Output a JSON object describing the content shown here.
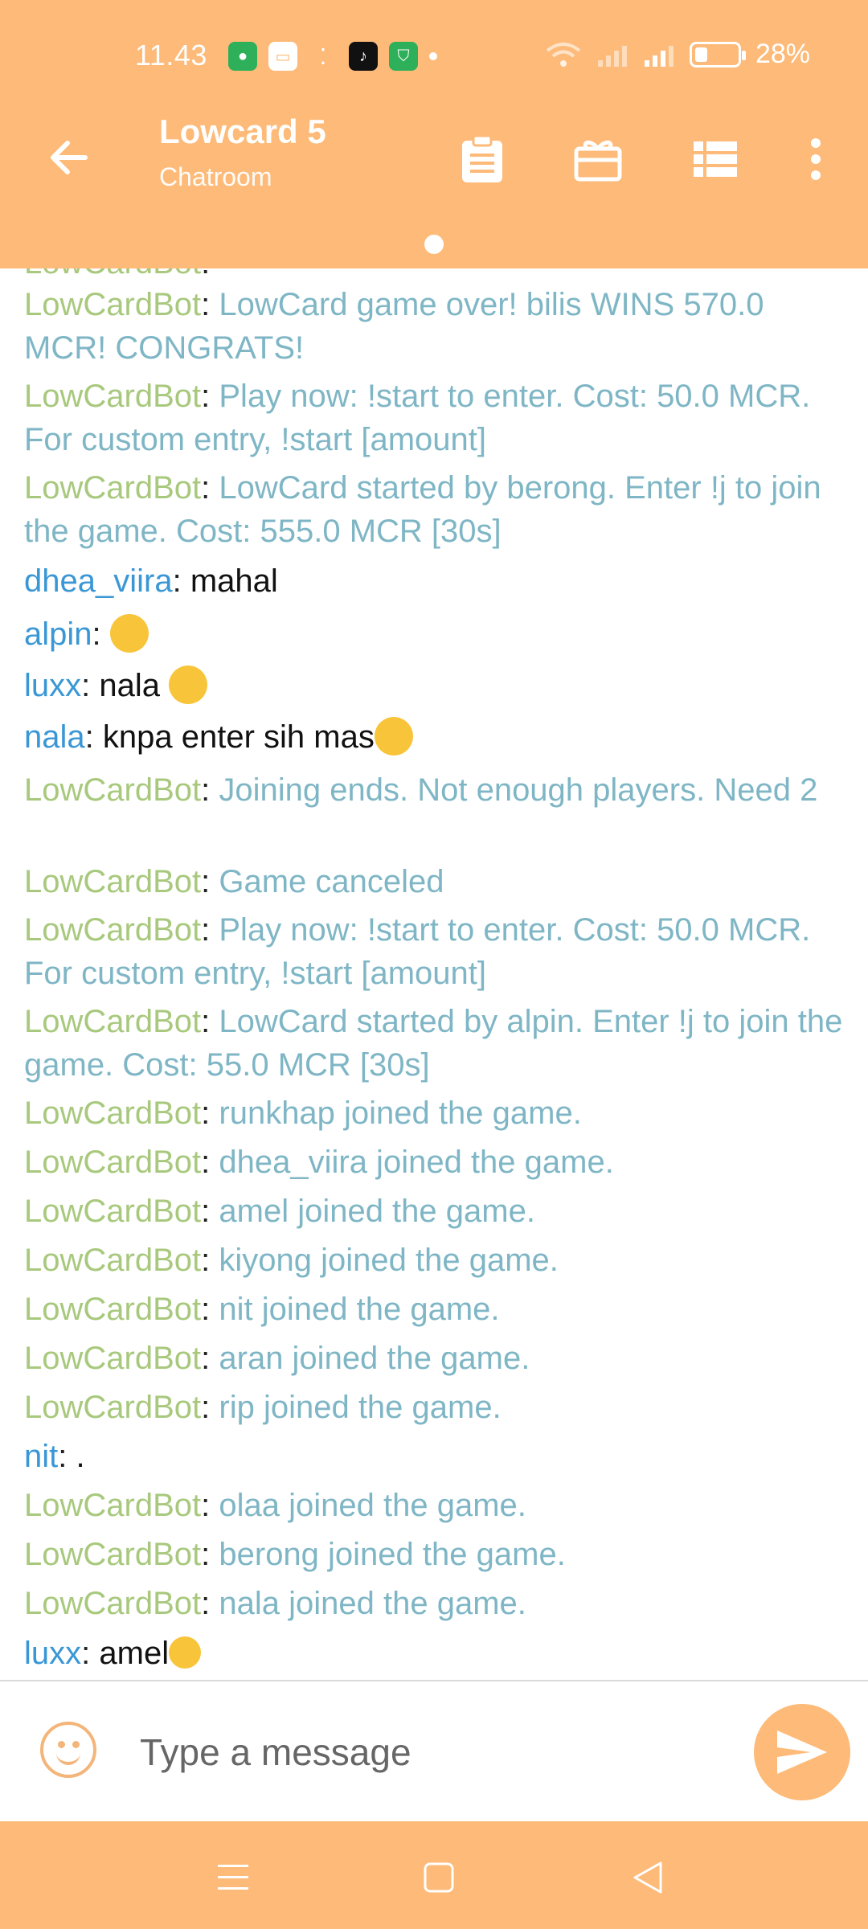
{
  "status_bar": {
    "time": "11.43",
    "battery": "28%",
    "battery_level": 0.28
  },
  "header": {
    "title": "Lowcard 5",
    "subtitle": "Chatroom"
  },
  "chat": {
    "messages": [
      {
        "user": "LowCardBot",
        "text": "LowCard game over! bilis WINS 570.0 MCR! CONGRATS!"
      },
      {
        "user": "LowCardBot",
        "text": "Play now: !start to enter. Cost: 50.0 MCR. For custom entry, !start [amount]"
      },
      {
        "user": "LowCardBot",
        "text": "LowCard started by berong. Enter !j to join the game. Cost: 555.0 MCR [30s]"
      },
      {
        "user": "dhea_viira",
        "text": "mahal"
      },
      {
        "user": "alpin",
        "text": ""
      },
      {
        "user": "luxx",
        "text": "nala"
      },
      {
        "user": "nala",
        "text": "knpa enter sih mas"
      },
      {
        "user": "LowCardBot",
        "text": "Joining ends. Not enough players. Need 2"
      },
      {
        "user": "LowCardBot",
        "text": "Game canceled"
      },
      {
        "user": "LowCardBot",
        "text": "Play now: !start to enter. Cost: 50.0 MCR. For custom entry, !start [amount]"
      },
      {
        "user": "LowCardBot",
        "text": "LowCard started by alpin. Enter !j to join the game. Cost: 55.0 MCR [30s]"
      },
      {
        "user": "LowCardBot",
        "text": "runkhap joined the game."
      },
      {
        "user": "LowCardBot",
        "text": "dhea_viira joined the game."
      },
      {
        "user": "LowCardBot",
        "text": "amel joined the game."
      },
      {
        "user": "LowCardBot",
        "text": "kiyong joined the game."
      },
      {
        "user": "LowCardBot",
        "text": "nit joined the game."
      },
      {
        "user": "LowCardBot",
        "text": "aran joined the game."
      },
      {
        "user": "LowCardBot",
        "text": "rip joined the game."
      },
      {
        "user": "nit",
        "text": "."
      },
      {
        "user": "LowCardBot",
        "text": "olaa joined the game."
      },
      {
        "user": "LowCardBot",
        "text": "berong joined the game."
      },
      {
        "user": "LowCardBot",
        "text": "nala joined the game."
      },
      {
        "user": "luxx",
        "text": "amel"
      }
    ],
    "separator": ":"
  },
  "composer": {
    "placeholder": "Type a message"
  },
  "colors": {
    "accent": "#FDBA78",
    "bot_name": "#A8C97D",
    "bot_text": "#7FB6C5",
    "user_name": "#3A97D6"
  },
  "icons": {
    "back": "arrow-left-icon",
    "clipboard": "clipboard-icon",
    "gift": "gift-icon",
    "list": "list-icon",
    "more": "more-vertical-icon",
    "emoji": "emoji-icon",
    "send": "send-icon",
    "nav_menu": "menu-icon",
    "nav_home": "home-square-icon",
    "nav_back": "back-triangle-icon"
  }
}
